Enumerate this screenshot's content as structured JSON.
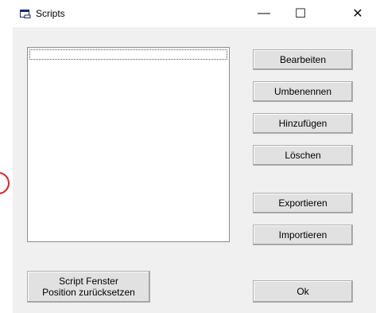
{
  "window": {
    "title": "Scripts",
    "controls": {
      "minimize": "—",
      "maximize": "☐",
      "close": "✕"
    }
  },
  "list": {
    "items": []
  },
  "buttons": {
    "edit": "Bearbeiten",
    "rename": "Umbenennen",
    "add": "Hinzufügen",
    "delete": "Löschen",
    "export": "Exportieren",
    "import": "Importieren",
    "reset_line1": "Script Fenster",
    "reset_line2": "Position zurücksetzen",
    "ok": "Ok"
  },
  "colors": {
    "window_bg": "#f0f0f0",
    "titlebar_bg": "#ffffff",
    "annotation": "#e02020"
  }
}
